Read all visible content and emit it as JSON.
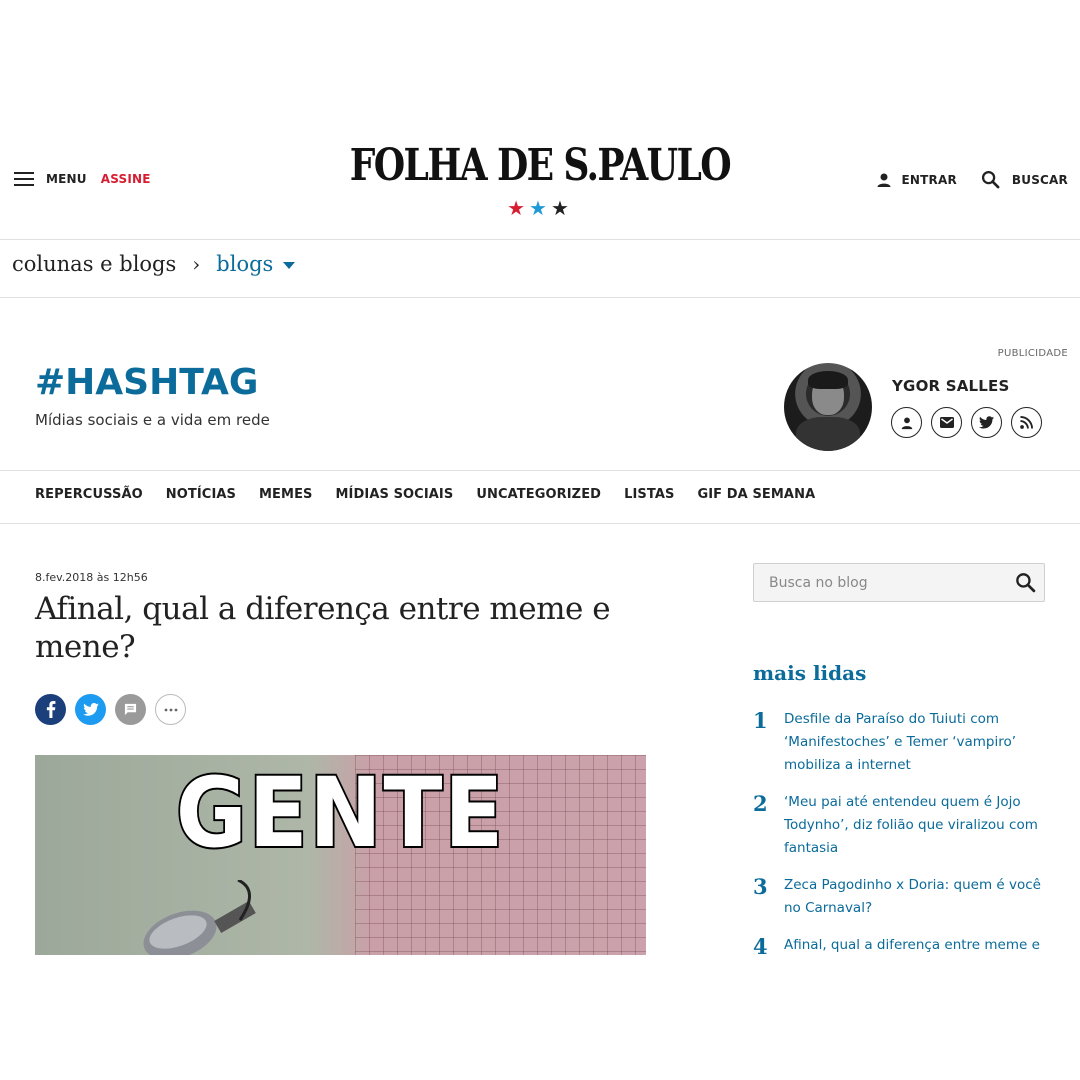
{
  "header": {
    "menu_label": "MENU",
    "subscribe_label": "ASSINE",
    "logo_text": "FOLHA DE S.PAULO",
    "stars": [
      {
        "glyph": "★",
        "color": "#d81d32"
      },
      {
        "glyph": "★",
        "color": "#1f9ad6"
      },
      {
        "glyph": "★",
        "color": "#222222"
      }
    ],
    "login_label": "ENTRAR",
    "search_label": "BUSCAR"
  },
  "breadcrumb": {
    "parent": "colunas e blogs",
    "separator": "›",
    "current": "blogs"
  },
  "blog": {
    "ad_label": "PUBLICIDADE",
    "title": "#HASHTAG",
    "subtitle": "Mídias sociais e a vida em rede",
    "author": {
      "name": "YGOR SALLES",
      "icons": [
        "user-icon",
        "email-icon",
        "twitter-icon",
        "rss-icon"
      ]
    }
  },
  "nav": {
    "items": [
      "REPERCUSSÃO",
      "NOTÍCIAS",
      "MEMES",
      "MÍDIAS SOCIAIS",
      "UNCATEGORIZED",
      "LISTAS",
      "GIF DA SEMANA"
    ]
  },
  "article": {
    "date": "8.fev.2018 às 12h56",
    "headline": "Afinal, qual a diferença entre meme e mene?",
    "share": [
      {
        "icon": "facebook-icon",
        "color": "#1b3f7a"
      },
      {
        "icon": "twitter-icon",
        "color": "#1d9bf0"
      },
      {
        "icon": "comment-icon",
        "color": "#9a9a9a"
      },
      {
        "icon": "more-icon",
        "color": "#ffffff"
      }
    ],
    "image_text": "GENTE"
  },
  "sidebar": {
    "search_placeholder": "Busca no blog",
    "most_read_title": "mais lidas",
    "most_read": [
      {
        "num": "1",
        "text": "Desfile da Paraíso do Tuiuti com ‘Manifestoches’ e Temer ‘vampiro’ mobiliza a internet"
      },
      {
        "num": "2",
        "text": "‘Meu pai até entendeu quem é Jojo Todynho’, diz folião que viralizou com fantasia"
      },
      {
        "num": "3",
        "text": "Zeca Pagodinho x Doria: quem é você no Carnaval?"
      },
      {
        "num": "4",
        "text": "Afinal, qual a diferença entre meme e mene?"
      }
    ]
  },
  "colors": {
    "accent_blue": "#0b6b9a",
    "brand_red": "#d81d32"
  }
}
